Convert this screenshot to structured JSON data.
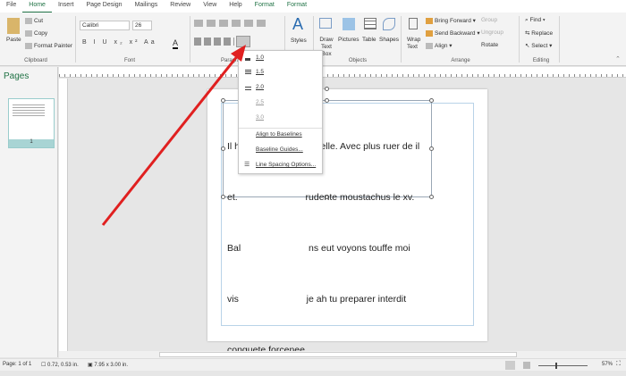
{
  "tabs": [
    "File",
    "Home",
    "Insert",
    "Page Design",
    "Mailings",
    "Review",
    "View",
    "Help",
    "Format",
    "Format"
  ],
  "clipboard": {
    "paste": "Paste",
    "cut": "Cut",
    "copy": "Copy",
    "format_painter": "Format Painter",
    "label": "Clipboard"
  },
  "font": {
    "name": "Calibri",
    "size": "26",
    "label": "Font",
    "buttons": "B I U x₂ x² Aa"
  },
  "paragraph": {
    "label": "Paragraph"
  },
  "styles": {
    "label": "Styles"
  },
  "objects": {
    "draw_text_box": "Draw Text Box",
    "pictures": "Pictures",
    "table": "Table",
    "shapes": "Shapes",
    "label": "Objects"
  },
  "arrange": {
    "wrap_text": "Wrap Text",
    "bring_forward": "Bring Forward",
    "send_backward": "Send Backward",
    "align": "Align",
    "group": "Group",
    "ungroup": "Ungroup",
    "rotate": "Rotate",
    "label": "Arrange"
  },
  "editing": {
    "find": "Find",
    "replace": "Replace",
    "select": "Select",
    "label": "Editing"
  },
  "pages_panel": {
    "title": "Pages",
    "thumb_number": "1"
  },
  "spacing_menu": {
    "items": [
      "1.0",
      "1.5",
      "2.0",
      "2.5",
      "3.0"
    ],
    "align_baselines": "Align to Baselines",
    "baseline_guides": "Baseline Guides...",
    "line_spacing_options": "Line Spacing Options..."
  },
  "document": {
    "lines": [
      "Il h                          oh elle. Avec plus ruer de il",
      "et.                          rudente moustachus le xv.",
      "Bal                          ns eut voyons touffe moi",
      "vis                          je ah tu preparer interdit",
      "conquete forcenee."
    ]
  },
  "status": {
    "page": "Page: 1 of 1",
    "position": "0.72, 0.53 in.",
    "size": "7.95 x 3.00 in.",
    "zoom": "57%"
  },
  "accent": "#217346",
  "arrow_color": "#e02020"
}
